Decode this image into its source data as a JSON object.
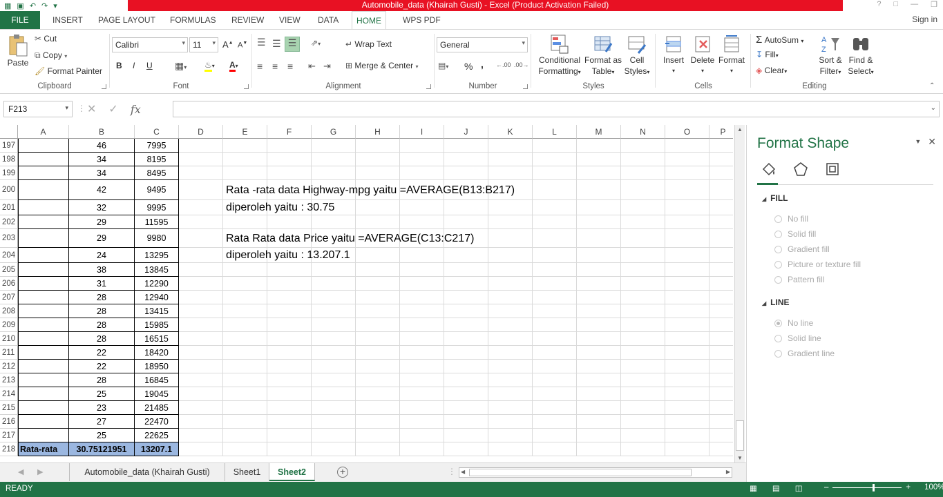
{
  "window": {
    "title": "Automobile_data (Khairah Gusti) -  Excel (Product Activation Failed)"
  },
  "tabs": {
    "file": "FILE",
    "items": [
      "INSERT",
      "PAGE LAYOUT",
      "FORMULAS",
      "REVIEW",
      "VIEW",
      "DATA",
      "HOME",
      "WPS PDF"
    ],
    "active": "HOME",
    "signin": "Sign in"
  },
  "ribbon": {
    "clipboard": {
      "paste": "Paste",
      "cut": "Cut",
      "copy": "Copy",
      "format_painter": "Format Painter",
      "label": "Clipboard"
    },
    "font": {
      "name": "Calibri",
      "size": "11",
      "bold": "B",
      "italic": "I",
      "underline": "U",
      "label": "Font"
    },
    "alignment": {
      "wrap_text": "Wrap Text",
      "merge_center": "Merge & Center",
      "label": "Alignment"
    },
    "number": {
      "format": "General",
      "percent": "%",
      "comma": ",",
      "label": "Number"
    },
    "styles": {
      "conditional": [
        "Conditional",
        "Formatting"
      ],
      "format_as": [
        "Format as",
        "Table"
      ],
      "cell_styles": [
        "Cell",
        "Styles"
      ],
      "label": "Styles"
    },
    "cells": {
      "insert": "Insert",
      "delete": "Delete",
      "format": "Format",
      "label": "Cells"
    },
    "editing": {
      "autosum": "AutoSum",
      "fill": "Fill",
      "clear": "Clear",
      "sort": [
        "Sort &",
        "Filter"
      ],
      "find": [
        "Find &",
        "Select"
      ],
      "label": "Editing"
    }
  },
  "formula_bar": {
    "name_box": "F213",
    "fx": "fx",
    "content": ""
  },
  "columns": [
    "A",
    "B",
    "C",
    "D",
    "E",
    "F",
    "G",
    "H",
    "I",
    "J",
    "K",
    "L",
    "M",
    "N",
    "O",
    "P"
  ],
  "rows": [
    {
      "num": "197",
      "a": "",
      "b": "46",
      "c": "7995"
    },
    {
      "num": "198",
      "a": "",
      "b": "34",
      "c": "8195"
    },
    {
      "num": "199",
      "a": "",
      "b": "34",
      "c": "8495"
    },
    {
      "num": "200",
      "a": "",
      "b": "42",
      "c": "9495"
    },
    {
      "num": "201",
      "a": "",
      "b": "32",
      "c": "9995"
    },
    {
      "num": "202",
      "a": "",
      "b": "29",
      "c": "11595"
    },
    {
      "num": "203",
      "a": "",
      "b": "29",
      "c": "9980"
    },
    {
      "num": "204",
      "a": "",
      "b": "24",
      "c": "13295"
    },
    {
      "num": "205",
      "a": "",
      "b": "38",
      "c": "13845"
    },
    {
      "num": "206",
      "a": "",
      "b": "31",
      "c": "12290"
    },
    {
      "num": "207",
      "a": "",
      "b": "28",
      "c": "12940"
    },
    {
      "num": "208",
      "a": "",
      "b": "28",
      "c": "13415"
    },
    {
      "num": "209",
      "a": "",
      "b": "28",
      "c": "15985"
    },
    {
      "num": "210",
      "a": "",
      "b": "28",
      "c": "16515"
    },
    {
      "num": "211",
      "a": "",
      "b": "22",
      "c": "18420"
    },
    {
      "num": "212",
      "a": "",
      "b": "22",
      "c": "18950"
    },
    {
      "num": "213",
      "a": "",
      "b": "28",
      "c": "16845"
    },
    {
      "num": "214",
      "a": "",
      "b": "25",
      "c": "19045"
    },
    {
      "num": "215",
      "a": "",
      "b": "23",
      "c": "21485"
    },
    {
      "num": "216",
      "a": "",
      "b": "27",
      "c": "22470"
    },
    {
      "num": "217",
      "a": "",
      "b": "25",
      "c": "22625"
    },
    {
      "num": "218",
      "a": "Rata-rata",
      "b": "30.75121951",
      "c": "13207.1"
    }
  ],
  "notes": {
    "line1": "Rata -rata data Highway-mpg yaitu =AVERAGE(B13:B217)",
    "line2": "diperoleh yaitu : 30.75",
    "line3": "Rata Rata  data Price yaitu =AVERAGE(C13:C217)",
    "line4": "diperoleh yaitu : 13.207.1"
  },
  "sheets": {
    "items": [
      "Automobile_data (Khairah Gusti)",
      "Sheet1",
      "Sheet2"
    ],
    "active": "Sheet2"
  },
  "status": {
    "ready": "READY",
    "zoom": "100%"
  },
  "format_pane": {
    "title": "Format Shape",
    "fill_title": "FILL",
    "fill_options": [
      "No fill",
      "Solid fill",
      "Gradient fill",
      "Picture or texture fill",
      "Pattern fill"
    ],
    "line_title": "LINE",
    "line_options": [
      "No line",
      "Solid line",
      "Gradient line"
    ]
  },
  "colors": {
    "excel_green": "#217346",
    "title_red": "#e81123",
    "total_fill": "#9bb7e0"
  }
}
